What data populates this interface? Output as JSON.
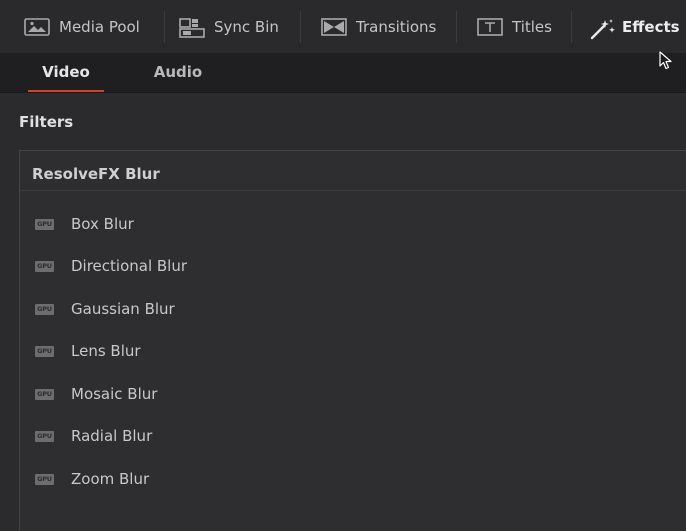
{
  "toolbar": {
    "items": [
      {
        "label": "Media Pool",
        "icon": "media-pool-icon"
      },
      {
        "label": "Sync Bin",
        "icon": "sync-bin-icon"
      },
      {
        "label": "Transitions",
        "icon": "transitions-icon"
      },
      {
        "label": "Titles",
        "icon": "titles-icon"
      },
      {
        "label": "Effects",
        "icon": "effects-wand-icon",
        "active": true
      }
    ]
  },
  "tabs": {
    "video": "Video",
    "audio": "Audio",
    "active": "Video"
  },
  "filters": {
    "title": "Filters",
    "group": {
      "name": "ResolveFX Blur",
      "items": [
        {
          "badge": "GPU",
          "label": "Box Blur"
        },
        {
          "badge": "GPU",
          "label": "Directional Blur"
        },
        {
          "badge": "GPU",
          "label": "Gaussian Blur"
        },
        {
          "badge": "GPU",
          "label": "Lens Blur"
        },
        {
          "badge": "GPU",
          "label": "Mosaic Blur"
        },
        {
          "badge": "GPU",
          "label": "Radial Blur"
        },
        {
          "badge": "GPU",
          "label": "Zoom Blur"
        }
      ]
    }
  },
  "colors": {
    "accent": "#d3412d",
    "background": "#2b2b2e",
    "tab_bar": "#1f1f22"
  }
}
